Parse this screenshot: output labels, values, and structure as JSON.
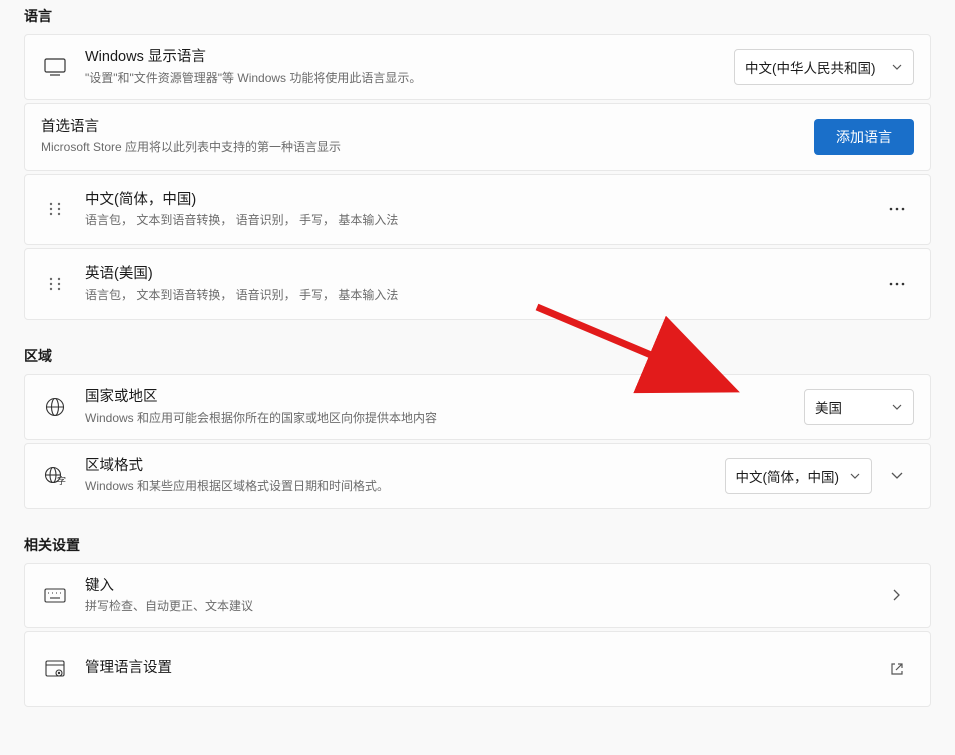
{
  "sections": {
    "language": "语言",
    "region": "区域",
    "related": "相关设置"
  },
  "displayLanguage": {
    "title": "Windows 显示语言",
    "sub": "\"设置\"和\"文件资源管理器\"等 Windows 功能将使用此语言显示。",
    "value": "中文(中华人民共和国)"
  },
  "preferred": {
    "title": "首选语言",
    "sub": "Microsoft Store 应用将以此列表中支持的第一种语言显示",
    "addBtn": "添加语言"
  },
  "langs": [
    {
      "name": "中文(简体，中国)",
      "detail": "语言包，  文本到语音转换，  语音识别，  手写，  基本输入法"
    },
    {
      "name": "英语(美国)",
      "detail": "语言包，  文本到语音转换，  语音识别，  手写，  基本输入法"
    }
  ],
  "country": {
    "title": "国家或地区",
    "sub": "Windows 和应用可能会根据你所在的国家或地区向你提供本地内容",
    "value": "美国"
  },
  "regionFormat": {
    "title": "区域格式",
    "sub": "Windows 和某些应用根据区域格式设置日期和时间格式。",
    "value": "中文(简体，中国)"
  },
  "typing": {
    "title": "键入",
    "sub": "拼写检查、自动更正、文本建议"
  },
  "admin": {
    "title": "管理语言设置"
  }
}
